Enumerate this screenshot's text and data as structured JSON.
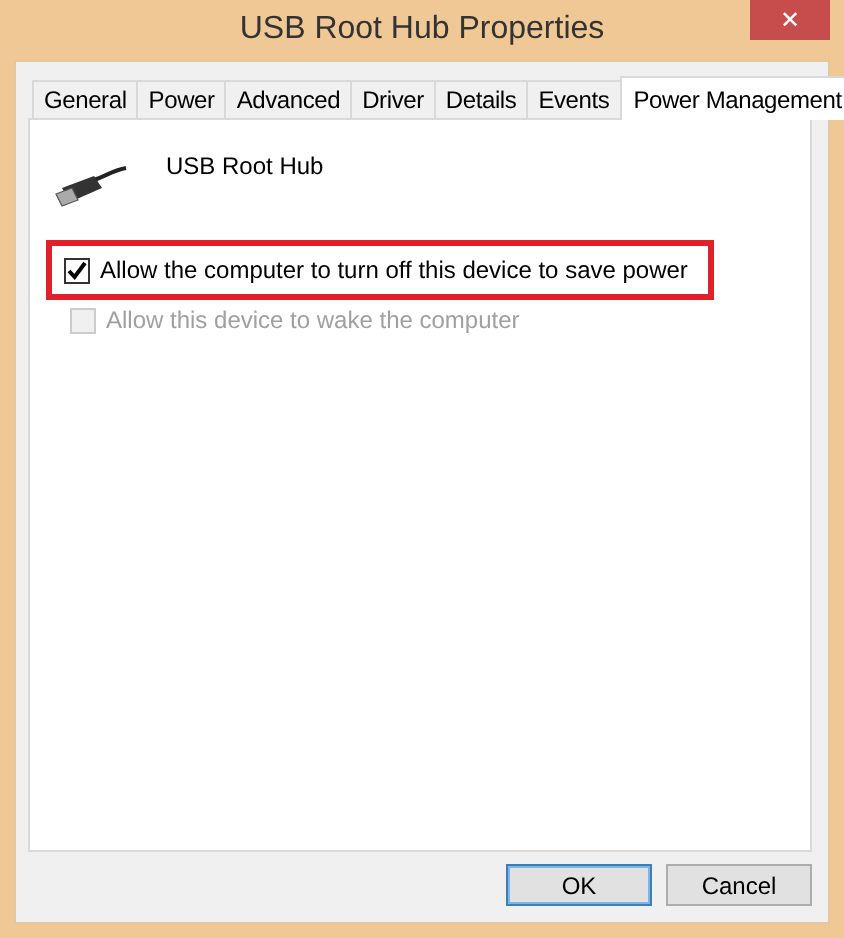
{
  "window": {
    "title": "USB Root Hub Properties",
    "close": "✕"
  },
  "tabs": [
    {
      "label": "General",
      "selected": false
    },
    {
      "label": "Power",
      "selected": false
    },
    {
      "label": "Advanced",
      "selected": false
    },
    {
      "label": "Driver",
      "selected": false
    },
    {
      "label": "Details",
      "selected": false
    },
    {
      "label": "Events",
      "selected": false
    },
    {
      "label": "Power Management",
      "selected": true
    }
  ],
  "device": {
    "name": "USB Root Hub"
  },
  "options": [
    {
      "label": "Allow the computer to turn off this device to save power",
      "checked": true,
      "disabled": false,
      "highlighted": true
    },
    {
      "label": "Allow this device to wake the computer",
      "checked": false,
      "disabled": true,
      "highlighted": false
    }
  ],
  "buttons": [
    {
      "label": "OK",
      "default": true
    },
    {
      "label": "Cancel",
      "default": false
    }
  ]
}
